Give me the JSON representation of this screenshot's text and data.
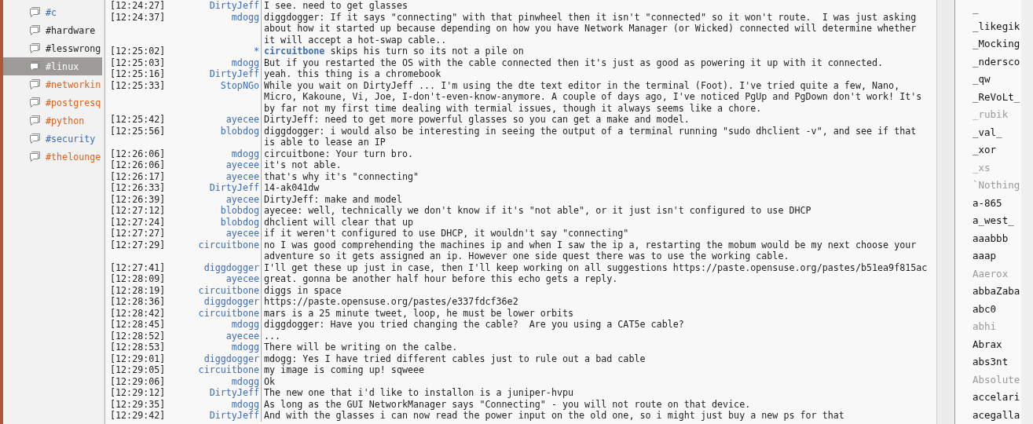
{
  "channels": [
    {
      "label": "#c",
      "color": "#3d6db5",
      "selected": false
    },
    {
      "label": "#hardware",
      "color": "#222222",
      "selected": false
    },
    {
      "label": "#lesswrong",
      "color": "#222222",
      "selected": false
    },
    {
      "label": "#linux",
      "color": "#ffffff",
      "selected": true
    },
    {
      "label": "#networkin",
      "color": "#d9631e",
      "selected": false
    },
    {
      "label": "#postgresq",
      "color": "#d9631e",
      "selected": false
    },
    {
      "label": "#python",
      "color": "#d9631e",
      "selected": false
    },
    {
      "label": "#security",
      "color": "#3d6db5",
      "selected": false
    },
    {
      "label": "#thelounge",
      "color": "#d9631e",
      "selected": false
    }
  ],
  "messages": [
    {
      "kind": "message",
      "time": "[12:24:27]",
      "nick": "DirtyJeff",
      "text": "I see. need to get glasses"
    },
    {
      "kind": "message",
      "time": "[12:24:37]",
      "nick": "mdogg",
      "text": "diggdogger: If it says \"connecting\" with that pinwheel then it isn't \"connected\" so it won't route.  I was just asking about how it started up because depending on how you have Network Manager (or Wicked) connected will determine whether it will accept a hot-swap cable.."
    },
    {
      "kind": "action",
      "time": "[12:25:02]",
      "nick": "*",
      "text": "**circuitbone** skips his turn so its not a pile on"
    },
    {
      "kind": "message",
      "time": "[12:25:03]",
      "nick": "mdogg",
      "text": "But if you restarted the OS with the cable connected then it's just as good as powering it up with it connected."
    },
    {
      "kind": "message",
      "time": "[12:25:16]",
      "nick": "DirtyJeff",
      "text": "yeah. this thing is a chromebook"
    },
    {
      "kind": "message",
      "time": "[12:25:33]",
      "nick": "StopNGo",
      "text": "While you wait on DirtyJeff ... I'm using the dte text editor in the terminal (Foot). I've tried quite a few, Nano, Micro, Kakoune, Vi, Joe, I-don't-even-know-anymore. A couple of days ago, I've noticed PgUp and PgDown don't work! It's by far not my first time dealing with termial issues, though it always seems like a chore."
    },
    {
      "kind": "message",
      "time": "[12:25:42]",
      "nick": "ayecee",
      "text": "DirtyJeff: need to get more powerful glasses so you can get a make and model."
    },
    {
      "kind": "message",
      "time": "[12:25:56]",
      "nick": "blobdog",
      "text": "diggdogger: i would also be interesting in seeing the output of a terminal running \"sudo dhclient -v\", and see if that is able to lease an IP"
    },
    {
      "kind": "message",
      "time": "[12:26:06]",
      "nick": "mdogg",
      "text": "circuitbone: Your turn bro."
    },
    {
      "kind": "message",
      "time": "[12:26:06]",
      "nick": "ayecee",
      "text": "it's not able."
    },
    {
      "kind": "message",
      "time": "[12:26:17]",
      "nick": "ayecee",
      "text": "that's why it's \"connecting\""
    },
    {
      "kind": "message",
      "time": "[12:26:33]",
      "nick": "DirtyJeff",
      "text": "14-ak041dw"
    },
    {
      "kind": "message",
      "time": "[12:26:39]",
      "nick": "ayecee",
      "text": "DirtyJeff: make and model"
    },
    {
      "kind": "message",
      "time": "[12:27:12]",
      "nick": "blobdog",
      "text": "ayecee: well, technically we don't know if it's \"not able\", or it just isn't configured to use DHCP"
    },
    {
      "kind": "message",
      "time": "[12:27:24]",
      "nick": "blobdog",
      "text": "dhclient will clear that up"
    },
    {
      "kind": "message",
      "time": "[12:27:27]",
      "nick": "ayecee",
      "text": "if it weren't configured to use DHCP, it wouldn't say \"connecting\""
    },
    {
      "kind": "message",
      "time": "[12:27:29]",
      "nick": "circuitbone",
      "text": "no I was good comprehending the machines ip and when I saw the ip a, restarting the mobum would be my next choose your adventure so it gets assigned an ip. However one side quest there was to use the working cable."
    },
    {
      "kind": "message",
      "time": "[12:27:41]",
      "nick": "diggdogger",
      "text": "I'll get these up just in case, then I'll keep working on all suggestions https://paste.opensuse.org/pastes/b51ea9f815ac"
    },
    {
      "kind": "message",
      "time": "[12:28:09]",
      "nick": "ayecee",
      "text": "great. gonna be another half hour before this echo gets a reply."
    },
    {
      "kind": "message",
      "time": "[12:28:19]",
      "nick": "circuitbone",
      "text": "diggs in space"
    },
    {
      "kind": "message",
      "time": "[12:28:36]",
      "nick": "diggdogger",
      "text": "https://paste.opensuse.org/pastes/e337fdcf36e2"
    },
    {
      "kind": "message",
      "time": "[12:28:42]",
      "nick": "circuitbone",
      "text": "mars is a 25 minute tweet, loop, he must be lower orbits"
    },
    {
      "kind": "message",
      "time": "[12:28:45]",
      "nick": "mdogg",
      "text": "diggdogger: Have you tried changing the cable?  Are you using a CAT5e cable?"
    },
    {
      "kind": "message",
      "time": "[12:28:52]",
      "nick": "ayecee",
      "text": "..."
    },
    {
      "kind": "message",
      "time": "[12:28:53]",
      "nick": "mdogg",
      "text": "There will be writing on the calbe."
    },
    {
      "kind": "message",
      "time": "[12:29:01]",
      "nick": "diggdogger",
      "text": "mdogg: Yes I have tried different cables just to rule out a bad cable"
    },
    {
      "kind": "message",
      "time": "[12:29:05]",
      "nick": "circuitbone",
      "text": "my image is coming up! sqweee"
    },
    {
      "kind": "message",
      "time": "[12:29:06]",
      "nick": "mdogg",
      "text": "Ok"
    },
    {
      "kind": "message",
      "time": "[12:29:12]",
      "nick": "DirtyJeff",
      "text": "The new one that i'd like to installon is a juniper-hvpu"
    },
    {
      "kind": "message",
      "time": "[12:29:35]",
      "nick": "mdogg",
      "text": "As long as the GUI NetworkManager says \"Connecting\" - you will not route on that device."
    },
    {
      "kind": "message",
      "time": "[12:29:42]",
      "nick": "DirtyJeff",
      "text": "And with the glasses i can now read the power input on the old one, so i might just buy a new ps for that"
    }
  ],
  "users": [
    {
      "name": "_",
      "away": false
    },
    {
      "name": "_likegik",
      "away": false
    },
    {
      "name": "_Mocking",
      "away": false
    },
    {
      "name": "_ndersco",
      "away": false
    },
    {
      "name": "_qw",
      "away": false
    },
    {
      "name": "_ReVoLt_",
      "away": false
    },
    {
      "name": "_rubik",
      "away": true
    },
    {
      "name": "_val_",
      "away": false
    },
    {
      "name": "_xor",
      "away": false
    },
    {
      "name": "_xs",
      "away": true
    },
    {
      "name": "`Nothing",
      "away": true
    },
    {
      "name": "a-865",
      "away": false
    },
    {
      "name": "a_west_",
      "away": false
    },
    {
      "name": "aaabbb",
      "away": false
    },
    {
      "name": "aaap",
      "away": false
    },
    {
      "name": "Aaerox",
      "away": true
    },
    {
      "name": "abbaZaba",
      "away": false
    },
    {
      "name": "abc0",
      "away": false
    },
    {
      "name": "abhi",
      "away": true
    },
    {
      "name": "Abrax",
      "away": false
    },
    {
      "name": "abs3nt",
      "away": false
    },
    {
      "name": "Absolute",
      "away": true
    },
    {
      "name": "accelari",
      "away": false
    },
    {
      "name": "acegalla",
      "away": false
    }
  ]
}
